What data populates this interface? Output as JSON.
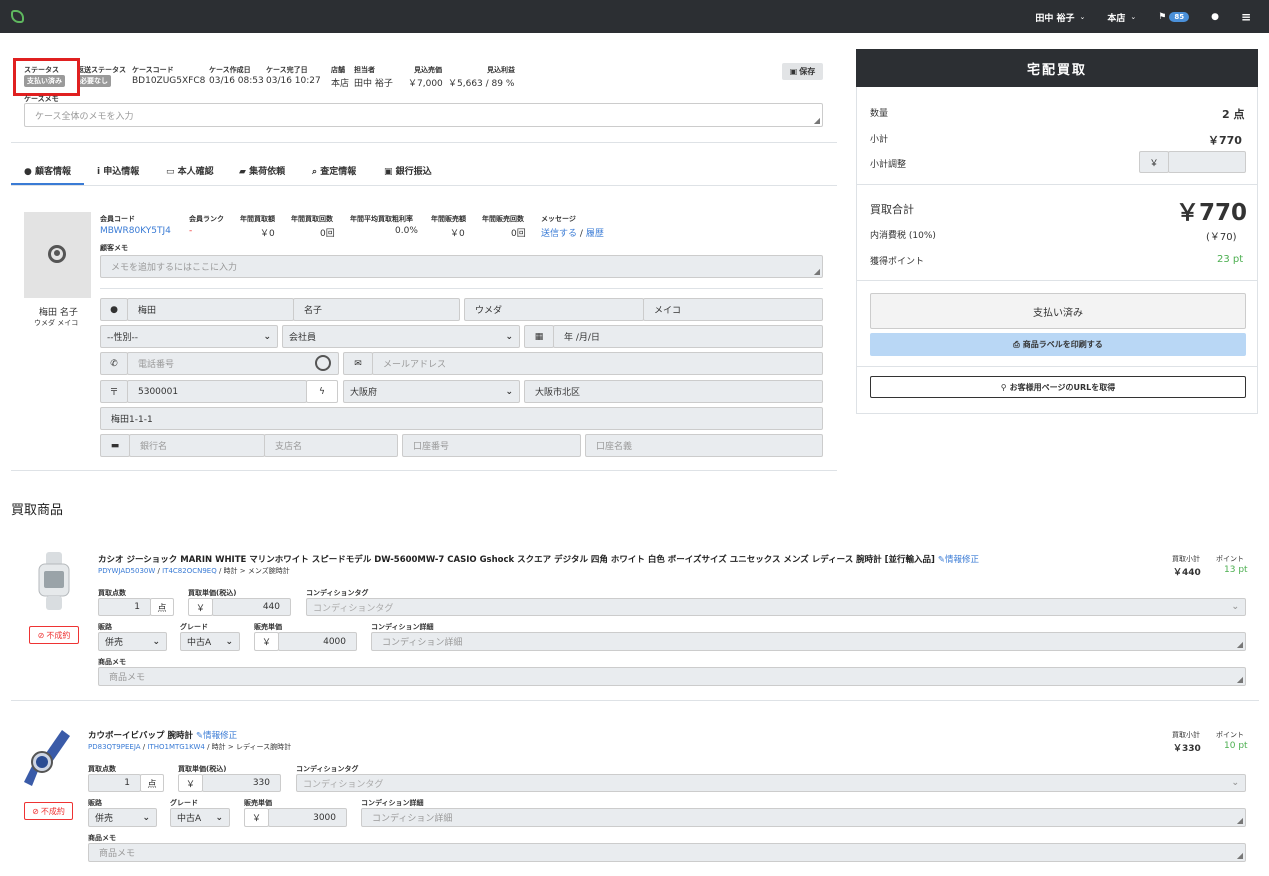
{
  "nav": {
    "user": "田中 裕子",
    "store": "本店",
    "flag_count": "85"
  },
  "case": {
    "labels": {
      "status": "ステータス",
      "shipping_status": "返送ステータス",
      "case_code": "ケースコード",
      "created": "ケース作成日",
      "completed": "ケース完了日",
      "store": "店舗",
      "staff": "担当者",
      "est_sales": "見込売価",
      "est_profit": "見込利益"
    },
    "status_badge": "支払い済み",
    "shipping_badge": "必要なし",
    "case_code": "BD10ZUG5XFC8",
    "created": "03/16 08:53",
    "completed": "03/16 10:27",
    "store": "本店",
    "staff": "田中 裕子",
    "est_sales": "￥7,000",
    "est_profit": "￥5,663 / 89 %",
    "save_label": "保存",
    "memo_label": "ケースメモ",
    "memo_placeholder": "ケース全体のメモを入力"
  },
  "tabs": [
    "顧客情報",
    "申込情報",
    "本人確認",
    "集荷依頼",
    "査定情報",
    "銀行振込"
  ],
  "customer": {
    "name": "梅田 名子",
    "kana": "ウメダ メイコ",
    "labels": {
      "member_code": "会員コード",
      "rank": "会員ランク",
      "annual_buy": "年間買取額",
      "annual_buy_count": "年間買取回数",
      "avg_margin": "年間平均買取粗利率",
      "annual_sales": "年間販売額",
      "annual_sales_count": "年間販売回数",
      "message": "メッセージ"
    },
    "member_code": "MBWR80KY5TJ4",
    "rank": "-",
    "annual_buy": "￥0",
    "annual_buy_count": "0回",
    "avg_margin": "0.0%",
    "annual_sales": "￥0",
    "annual_sales_count": "0回",
    "message_send": "送信する",
    "message_sep": "/",
    "message_history": "履歴",
    "memo_label": "顧客メモ",
    "memo_placeholder": "メモを追加するにはここに入力",
    "last_name": "梅田",
    "first_name": "名子",
    "last_kana": "ウメダ",
    "first_kana": "メイコ",
    "gender": "--性別--",
    "member_type": "会社員",
    "birthday": "年 /月/日",
    "phone_placeholder": "電話番号",
    "email_placeholder": "メールアドレス",
    "postal_mark": "〒",
    "zip": "5300001",
    "prefecture": "大阪府",
    "city": "大阪市北区",
    "address": "梅田1-1-1",
    "bank_placeholder": "銀行名",
    "branch_placeholder": "支店名",
    "account_no_placeholder": "口座番号",
    "account_name_placeholder": "口座名義"
  },
  "panel": {
    "title": "宅配買取",
    "qty_label": "数量",
    "qty": "2 点",
    "subtotal_label": "小計",
    "subtotal": "￥770",
    "adjust_label": "小計調整",
    "yen": "￥",
    "total_label": "買取合計",
    "total": "￥770",
    "tax_label": "内消費税 (10%)",
    "tax": "(￥70)",
    "points_label": "獲得ポイント",
    "points": "23 pt",
    "paid_button": "支払い済み",
    "print_button": "商品ラベルを印刷する",
    "url_button": "お客様用ページのURLを取得"
  },
  "section_title": "買取商品",
  "item_labels": {
    "qty": "買取点数",
    "unit_price": "買取単価(税込)",
    "cond_tag": "コンディションタグ",
    "channel": "販路",
    "grade": "グレード",
    "sale_price": "販売単価",
    "cond_detail": "コンディション詳細",
    "memo": "商品メモ",
    "subtotal": "買取小計",
    "point": "ポイント",
    "unit": "点",
    "ng": "不成約",
    "edit": "情報修正",
    "cond_tag_placeholder": "コンディションタグ",
    "cond_detail_placeholder": "コンディション詳細",
    "memo_placeholder": "商品メモ"
  },
  "items": [
    {
      "title": "カシオ ジーショック MARIN WHITE マリンホワイト スピードモデル DW-5600MW-7 CASIO Gshock スクエア デジタル 四角 ホワイト 白色 ボーイズサイズ ユニセックス メンズ レディース 腕時計 [並行輸入品]",
      "code1": "PDYWJAD5030W",
      "code2": "IT4C82OCN9EQ",
      "category": "時計 > メンズ腕時計",
      "subtotal": "￥440",
      "points": "13 pt",
      "qty": "1",
      "unit_price": "440",
      "channel": "併売",
      "grade": "中古A",
      "sale_price": "4000"
    },
    {
      "title": "カウボーイビバップ 腕時計",
      "code1": "PD83QT9PEEJA",
      "code2": "ITHO1MTG1KW4",
      "category": "時計 > レディース腕時計",
      "subtotal": "￥330",
      "points": "10 pt",
      "qty": "1",
      "unit_price": "330",
      "channel": "併売",
      "grade": "中古A",
      "sale_price": "3000"
    }
  ]
}
